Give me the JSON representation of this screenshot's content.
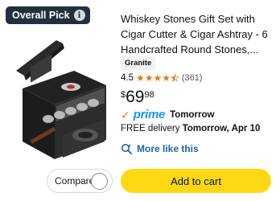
{
  "badge": {
    "label": "Overall Pick",
    "icon": "info-icon"
  },
  "compare": {
    "label": "Compare"
  },
  "product": {
    "title": "Whiskey Stones Gift Set with Cigar Cutter & Cigar Ashtray - 6 Handcrafted Round Stones,...",
    "variant": "Granite",
    "rating": "4.5",
    "rating_value": 4.5,
    "review_count": "(361)",
    "price_symbol": "$",
    "price_whole": "69",
    "price_fraction": "98",
    "prime_label": "prime",
    "prime_delivery": "Tomorrow",
    "delivery_prefix": "FREE delivery ",
    "delivery_date": "Tomorrow, Apr 10",
    "more_like_label": "More like this",
    "add_to_cart_label": "Add to cart"
  },
  "colors": {
    "badge_bg": "#232f3e",
    "star": "#de7921",
    "prime_blue": "#1399ff",
    "link_blue": "#2162a1",
    "cart_yellow": "#ffd814"
  }
}
